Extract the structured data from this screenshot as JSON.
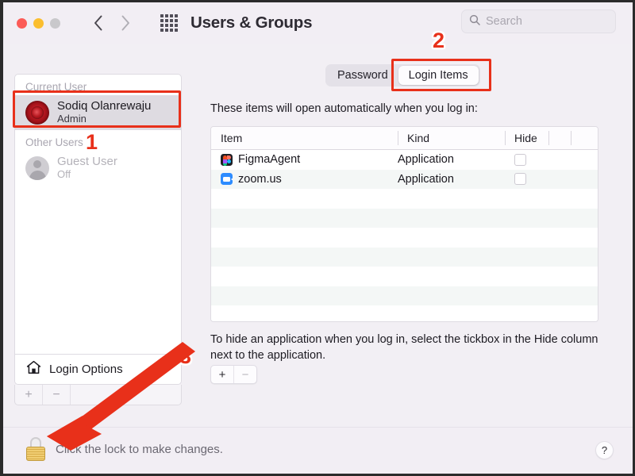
{
  "window": {
    "title": "Users & Groups",
    "traffic_lights": [
      "close",
      "minimize",
      "maximize"
    ],
    "nav": {
      "back": "back-chevron",
      "forward": "forward-chevron"
    },
    "grid_button": "show-all-grid-icon"
  },
  "search": {
    "placeholder": "Search",
    "value": "",
    "icon": "search-icon"
  },
  "sidebar": {
    "groups": [
      {
        "label": "Current User",
        "users": [
          {
            "name": "Sodiq Olanrewaju",
            "role": "Admin",
            "avatar": "rose-avatar",
            "selected": true,
            "dimmed": false
          }
        ]
      },
      {
        "label": "Other Users",
        "users": [
          {
            "name": "Guest User",
            "role": "Off",
            "avatar": "person-silhouette-avatar",
            "selected": false,
            "dimmed": true
          }
        ]
      }
    ],
    "login_options": {
      "label": "Login Options",
      "icon": "home-icon"
    },
    "buttons": {
      "add": "+",
      "remove": "−"
    }
  },
  "tabs": [
    {
      "label": "Password",
      "active": false
    },
    {
      "label": "Login Items",
      "active": true
    }
  ],
  "main": {
    "description": "These items will open automatically when you log in:",
    "table": {
      "columns": [
        "Item",
        "Kind",
        "Hide"
      ],
      "rows": [
        {
          "item": "FigmaAgent",
          "kind": "Application",
          "hide": false,
          "icon": "figma-app-icon"
        },
        {
          "item": "zoom.us",
          "kind": "Application",
          "hide": false,
          "icon": "zoom-app-icon"
        }
      ],
      "empty_rows": 8
    },
    "hint": "To hide an application when you log in, select the tickbox in the Hide column next to the application.",
    "buttons": {
      "add": "+",
      "remove": "−"
    }
  },
  "bottom": {
    "lock_text": "Click the lock to make changes.",
    "lock_icon": "closed-padlock-icon",
    "help_label": "?"
  },
  "annotations": {
    "numbers": [
      "1",
      "2",
      "3"
    ],
    "color": "#e8301a",
    "boxes": [
      "current-user-row",
      "login-items-tab"
    ],
    "arrow": "points-to-lock-button"
  }
}
